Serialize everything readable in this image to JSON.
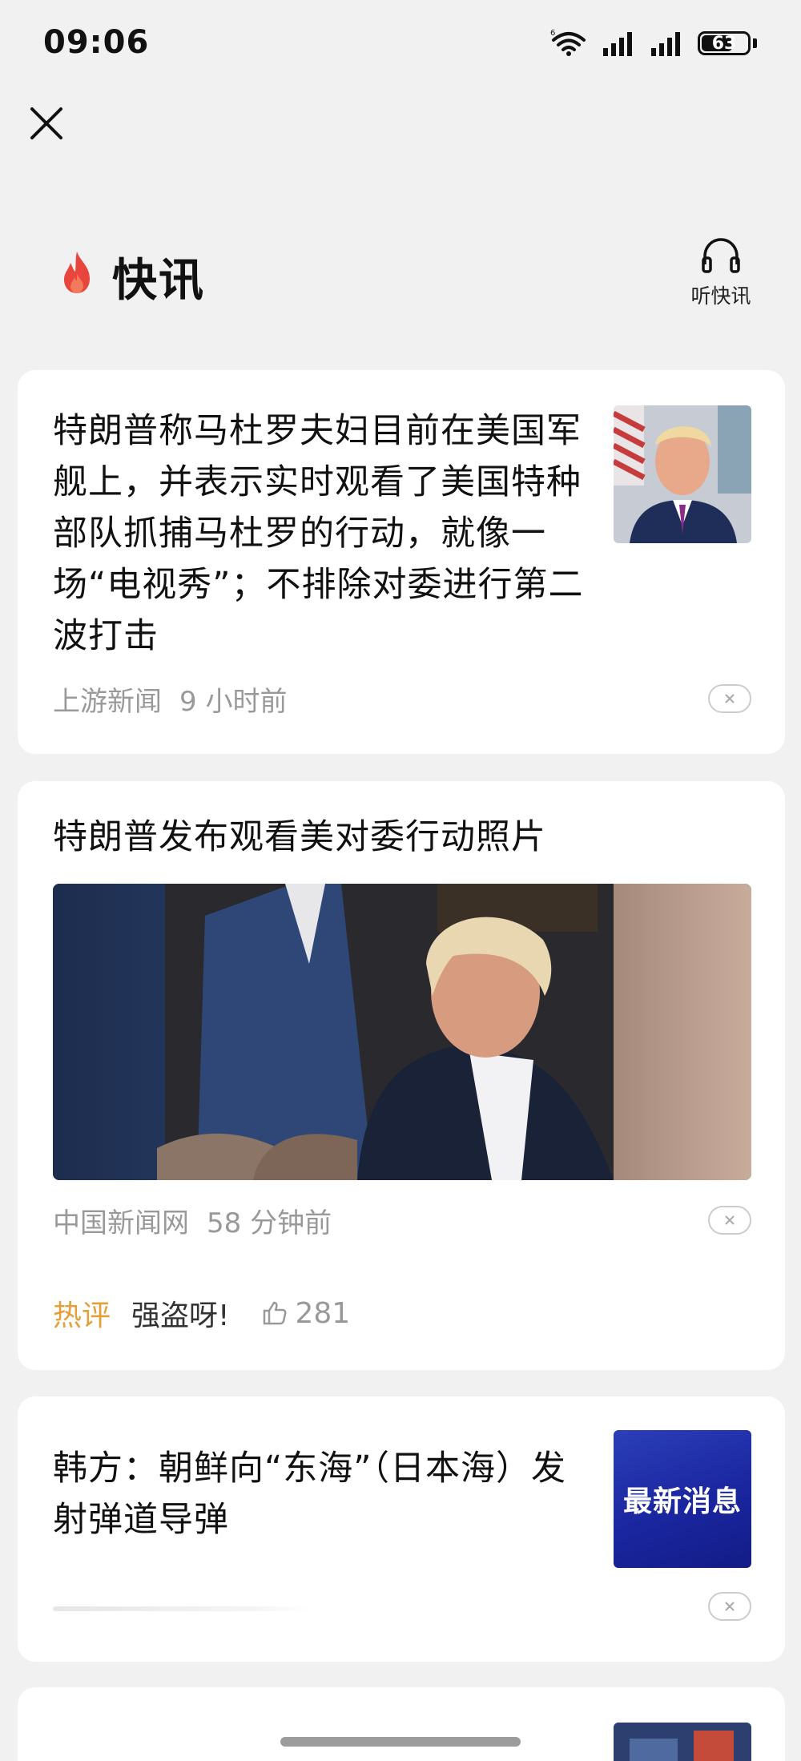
{
  "status_bar": {
    "time": "09:06",
    "battery": "63"
  },
  "header": {
    "title": "快讯",
    "listen_label": "听快讯"
  },
  "feed": [
    {
      "title": "特朗普称马杜罗夫妇目前在美国军舰上，并表示实时观看了美国特种部队抓捕马杜罗的行动，就像一场“电视秀”；不排除对委进行第二波打击",
      "source": "上游新闻",
      "time": "9 小时前"
    },
    {
      "title": "特朗普发布观看美对委行动照片",
      "source": "中国新闻网",
      "time": "58 分钟前",
      "comment_tag": "热评",
      "comment_text": "强盗呀!",
      "likes": "281"
    },
    {
      "title": "韩方：朝鲜向“东海”（日本海）发射弹道导弹",
      "thumb_text": "最新消息"
    }
  ],
  "colors": {
    "background": "#f1f1f2",
    "card": "#ffffff",
    "accent_fire": "#e8453c",
    "comment_tag": "#e3a03a",
    "meta_text": "#999999",
    "breaking_bg": "#1a26a0"
  },
  "icons": [
    "close-icon",
    "fire-icon",
    "headphones-icon",
    "dismiss-icon",
    "thumbs-up-icon",
    "wifi-icon",
    "signal-icon",
    "battery-icon"
  ]
}
